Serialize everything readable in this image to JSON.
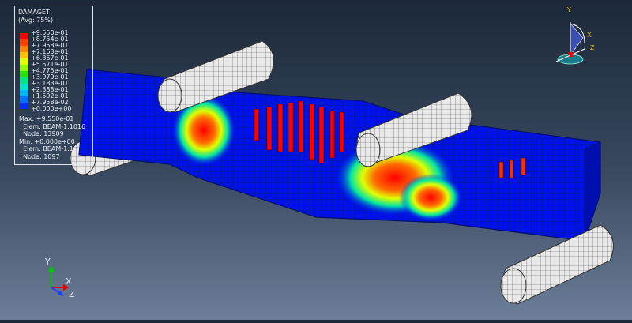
{
  "legend": {
    "variable": "DAMAGET",
    "averaging": "(Avg: 75%)",
    "levels": [
      {
        "value": "+9.550e-01",
        "color": "#ff0000"
      },
      {
        "value": "+8.754e-01",
        "color": "#ff4000"
      },
      {
        "value": "+7.958e-01",
        "color": "#ff8400"
      },
      {
        "value": "+7.163e-01",
        "color": "#ffc400"
      },
      {
        "value": "+6.367e-01",
        "color": "#e2ff00"
      },
      {
        "value": "+5.571e-01",
        "color": "#8eff00"
      },
      {
        "value": "+4.775e-01",
        "color": "#28e400"
      },
      {
        "value": "+3.979e-01",
        "color": "#00e680"
      },
      {
        "value": "+3.183e-01",
        "color": "#00e5d0"
      },
      {
        "value": "+2.388e-01",
        "color": "#00b7ff"
      },
      {
        "value": "+1.592e-01",
        "color": "#0070ff"
      },
      {
        "value": "+7.958e-02",
        "color": "#0031ff"
      },
      {
        "value": "+0.000e+00",
        "color": "#0000e0"
      }
    ],
    "stats_text": "Max: +9.550e-01\n  Elem: BEAM-1.1016\n  Node: 13909\nMin: +0.000e+00\n  Elem: BEAM-1.1\n  Node: 1097"
  },
  "triad": {
    "x": "X",
    "y": "Y",
    "z": "Z"
  },
  "view_cube": {
    "x": "X",
    "y": "Y",
    "z": "Z"
  }
}
